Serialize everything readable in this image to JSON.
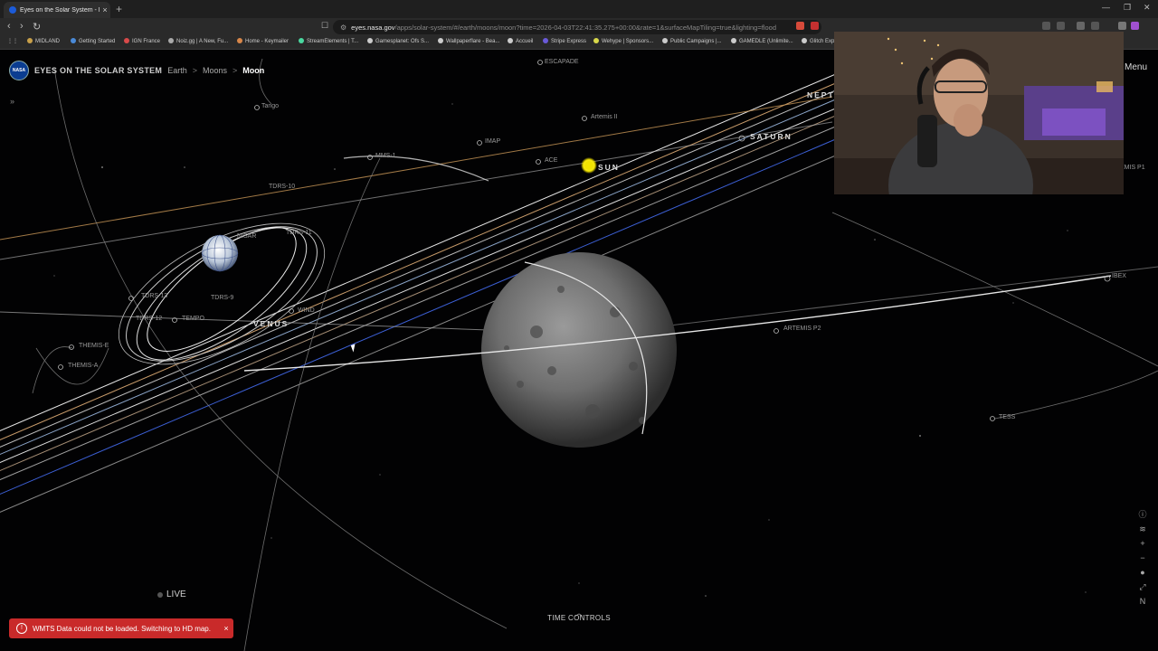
{
  "browser": {
    "tab_title": "Eyes on the Solar System - Moo",
    "tab_close": "×",
    "new_tab": "+",
    "url_host": "eyes.nasa.gov",
    "url_path": "/apps/solar-system/#/earth/moons/moon?time=2026-04-03T22:41:35.275+00:00&rate=1&surfaceMapTiling=true&lighting=flood",
    "bookmarks": [
      "MIDLAND",
      "Getting Started",
      "IGN France",
      "Noiz.gg | A New, Fu...",
      "Home - Keymailer",
      "StreamElements | T...",
      "Gamesplanet: Ofs S...",
      "Wallpaperflare - Bea...",
      "Accueil",
      "Stripe Express",
      "Wehype | Sponsors...",
      "Public Campaigns |...",
      "GAMEDLE (Unlimite...",
      "Glitch Exp"
    ],
    "bookmark_colors": [
      "#c8a04a",
      "#4a8ad8",
      "#d84a4a",
      "#aaaaaa",
      "#d8874a",
      "#4ad8a0",
      "#cccccc",
      "#cccccc",
      "#cccccc",
      "#6a5ad8",
      "#d8d84a",
      "#cccccc",
      "#cccccc",
      "#cccccc"
    ]
  },
  "app": {
    "logo": "NASA",
    "title": "EYES ON THE SOLAR SYSTEM",
    "breadcrumb": [
      "Earth",
      "Moons"
    ],
    "breadcrumb_sep": ">",
    "current": "Moon",
    "menu_label": "Menu",
    "expand_icon": "»"
  },
  "scene_labels": {
    "spacecraft": [
      {
        "id": "tango",
        "text": "Tango"
      },
      {
        "id": "escapade",
        "text": "ESCAPADE"
      },
      {
        "id": "artemis2",
        "text": "Artemis II"
      },
      {
        "id": "imap",
        "text": "IMAP"
      },
      {
        "id": "ace",
        "text": "ACE"
      },
      {
        "id": "mms1",
        "text": "MMS-1"
      },
      {
        "id": "tdrs10",
        "text": "TDRS-10"
      },
      {
        "id": "tdrs11",
        "text": "TDRS-11"
      },
      {
        "id": "nisar",
        "text": "NISAR"
      },
      {
        "id": "tdrs13",
        "text": "TDRS-13"
      },
      {
        "id": "tdrs9",
        "text": "TDRS-9"
      },
      {
        "id": "tdrs12",
        "text": "TDRS-12"
      },
      {
        "id": "tempo",
        "text": "TEMPO"
      },
      {
        "id": "wind",
        "text": "WIND"
      },
      {
        "id": "themise",
        "text": "THEMIS-E"
      },
      {
        "id": "themisa",
        "text": "THEMIS-A"
      },
      {
        "id": "artemisp2",
        "text": "ARTEMIS P2"
      },
      {
        "id": "artemisp1",
        "text": "EMIS P1"
      },
      {
        "id": "ibex",
        "text": "IBEX"
      },
      {
        "id": "tess",
        "text": "TESS"
      }
    ],
    "planets": [
      {
        "id": "sun",
        "text": "SUN"
      },
      {
        "id": "saturn",
        "text": "SATURN"
      },
      {
        "id": "venus",
        "text": "VENUS"
      },
      {
        "id": "neptune",
        "text": "NEPT"
      }
    ]
  },
  "controls": {
    "live": "LIVE",
    "time_controls": "TIME CONTROLS",
    "time_chevron": "︿",
    "right_tools": [
      "info-icon",
      "layers-icon",
      "zoom-in-icon",
      "zoom-out-icon",
      "lighting-icon",
      "fullscreen-icon",
      "north-icon"
    ],
    "right_tool_glyphs": [
      "ⓘ",
      "≋",
      "+",
      "−",
      "●",
      "⤢",
      "N"
    ]
  },
  "toast": {
    "icon": "!",
    "message": "WMTS Data could not be loaded. Switching to HD map.",
    "close": "×"
  },
  "colors": {
    "sun": "#f2e400",
    "toast_bg": "#c92a2a",
    "orbit": "#d8d8d8"
  }
}
